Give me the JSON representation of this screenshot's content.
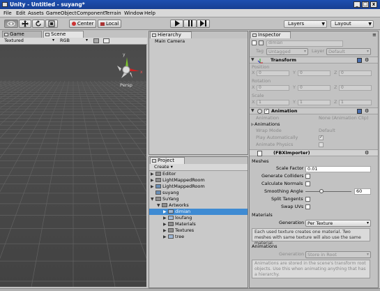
{
  "window": {
    "title": "Unity - Untitled - suyang*",
    "minimize": "_",
    "maximize": "□",
    "close": "x"
  },
  "menu": [
    "File",
    "Edit",
    "Assets",
    "GameObject",
    "Component",
    "Terrain",
    "Window",
    "Help"
  ],
  "toolbar": {
    "pivot": "Center",
    "space": "Local",
    "layers": "Layers",
    "layout": "Layout"
  },
  "game_tab": "Game",
  "scene": {
    "tab": "Scene",
    "mode": "Textured",
    "color": "RGB",
    "gizmo_label": "Persp",
    "gizmo_x": "x",
    "gizmo_y": "y"
  },
  "hierarchy": {
    "tab": "Hierarchy",
    "items": [
      "Main Camera"
    ]
  },
  "project": {
    "tab": "Project",
    "create": "Create",
    "items": [
      "Editor",
      "LightMappedRoom",
      "LightMappedRoom",
      "suyang",
      "SuYang",
      "Artworks",
      "dimian",
      "loufang",
      "Materials",
      "Textures",
      "tree"
    ]
  },
  "inspector": {
    "tab": "Inspector",
    "object_name": "dimian",
    "tag_label": "Tag",
    "tag_value": "Untagged",
    "layer_label": "Layer",
    "layer_value": "Default",
    "transform": {
      "title": "Transform",
      "position": "Position",
      "rotation": "Rotation",
      "scale": "Scale",
      "x": "X",
      "y": "Y",
      "z": "Z",
      "position_values": [
        "0",
        "0",
        "0"
      ],
      "rotation_values": [
        "0",
        "0",
        "0"
      ],
      "scale_values": [
        "1",
        "1",
        "1"
      ]
    },
    "animation": {
      "title": "Animation",
      "animation_label": "Animation",
      "animation_value": "None (Animation Clip)",
      "animations_label": "Animations",
      "wrap_label": "Wrap Mode",
      "wrap_value": "Default",
      "play_label": "Play Automatically",
      "physics_label": "Animate Physics"
    },
    "importer": {
      "title": "(FBXImporter)",
      "meshes": "Meshes",
      "scale_factor_label": "Scale Factor",
      "scale_factor_value": "0.01",
      "colliders": "Generate Colliders",
      "normals": "Calculate Normals",
      "smoothing_label": "Smoothing Angle",
      "smoothing_value": "60",
      "split": "Split Tangents",
      "swap": "Swap UVs",
      "materials": "Materials",
      "generation_label": "Generation",
      "generation_value": "Per Texture",
      "materials_help": "Each used texture creates one material. Two meshes with same texture will also use the same material.",
      "animations": "Animations",
      "anim_generation_label": "Generation",
      "anim_generation_value": "Store in Root",
      "animations_help": "Animations are stored in the scene's transform root objects. Use this when animating anything that has a hierarchy."
    }
  },
  "colors": {
    "selection": "#3f8bd3",
    "title_bar": "#1d4fb0",
    "scene_bg": "#4a4a4a"
  }
}
